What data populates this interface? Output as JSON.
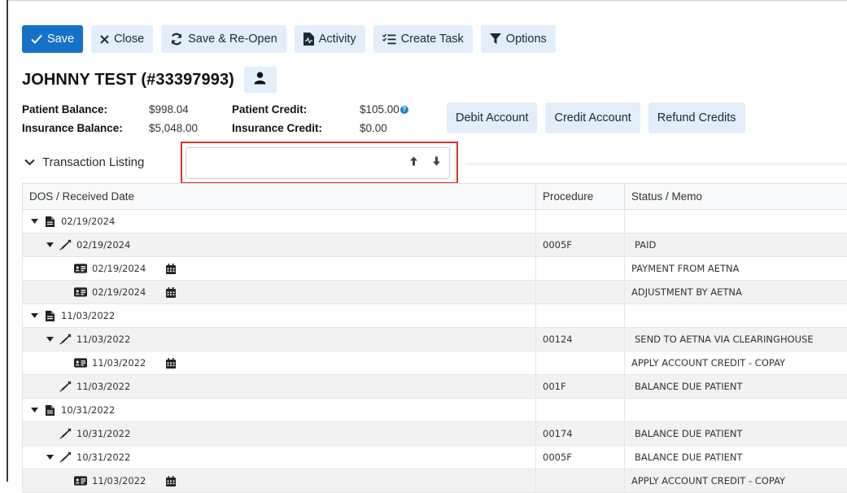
{
  "toolbar": {
    "save": "Save",
    "close": "Close",
    "save_reopen": "Save & Re-Open",
    "activity": "Activity",
    "create_task": "Create Task",
    "options": "Options"
  },
  "patient": {
    "title": "JOHNNY TEST (#33397993)"
  },
  "balances": {
    "patient_balance_label": "Patient Balance:",
    "patient_balance_value": "$998.04",
    "patient_credit_label": "Patient Credit:",
    "patient_credit_value": "$105.00",
    "insurance_balance_label": "Insurance Balance:",
    "insurance_balance_value": "$5,048.00",
    "insurance_credit_label": "Insurance Credit:",
    "insurance_credit_value": "$0.00"
  },
  "account_actions": {
    "debit": "Debit Account",
    "credit": "Credit Account",
    "refund": "Refund Credits"
  },
  "transactions": {
    "header": "Transaction Listing",
    "search_value": "",
    "columns": [
      "DOS / Received Date",
      "Procedure",
      "Status / Memo"
    ],
    "rows": [
      {
        "level": 0,
        "caret": true,
        "icon": "document-icon",
        "date": "02/19/2024",
        "calendar": false,
        "procedure": "",
        "status": ""
      },
      {
        "level": 1,
        "caret": true,
        "icon": "pen-icon",
        "date": "02/19/2024",
        "calendar": false,
        "procedure": "0005F",
        "status": "PAID"
      },
      {
        "level": 2,
        "caret": false,
        "icon": "payment-icon",
        "date": "02/19/2024",
        "calendar": true,
        "procedure": "",
        "status": "PAYMENT FROM AETNA"
      },
      {
        "level": 2,
        "caret": false,
        "icon": "payment-icon",
        "date": "02/19/2024",
        "calendar": true,
        "procedure": "",
        "status": "ADJUSTMENT BY AETNA"
      },
      {
        "level": 0,
        "caret": true,
        "icon": "document-icon",
        "date": "11/03/2022",
        "calendar": false,
        "procedure": "",
        "status": ""
      },
      {
        "level": 1,
        "caret": true,
        "icon": "pen-icon",
        "date": "11/03/2022",
        "calendar": false,
        "procedure": "00124",
        "status": "SEND TO AETNA VIA CLEARINGHOUSE"
      },
      {
        "level": 2,
        "caret": false,
        "icon": "payment-icon",
        "date": "11/03/2022",
        "calendar": true,
        "procedure": "",
        "status": "APPLY ACCOUNT CREDIT - COPAY"
      },
      {
        "level": 1,
        "caret": false,
        "icon": "pen-icon",
        "date": "11/03/2022",
        "calendar": false,
        "procedure": "001F",
        "status": "BALANCE DUE PATIENT"
      },
      {
        "level": 0,
        "caret": true,
        "icon": "document-icon",
        "date": "10/31/2022",
        "calendar": false,
        "procedure": "",
        "status": ""
      },
      {
        "level": 1,
        "caret": false,
        "icon": "pen-icon",
        "date": "10/31/2022",
        "calendar": false,
        "procedure": "00174",
        "status": "BALANCE DUE PATIENT"
      },
      {
        "level": 1,
        "caret": true,
        "icon": "pen-icon",
        "date": "10/31/2022",
        "calendar": false,
        "procedure": "0005F",
        "status": "BALANCE DUE PATIENT"
      },
      {
        "level": 2,
        "caret": false,
        "icon": "payment-icon",
        "date": "11/03/2022",
        "calendar": true,
        "procedure": "",
        "status": "APPLY ACCOUNT CREDIT - COPAY"
      }
    ]
  },
  "colors": {
    "primary": "#1671c9",
    "button_bg": "#e2eef9",
    "highlight_border": "#d9362b",
    "info": "#1a87c9"
  }
}
